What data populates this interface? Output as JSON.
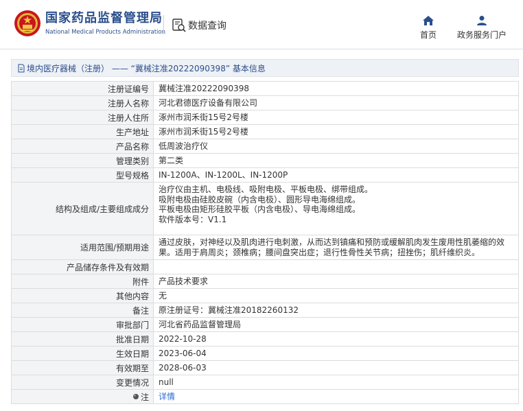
{
  "header": {
    "site_name_cn": "国家药品监督管理局",
    "site_name_en": "National Medical Products Administration",
    "data_query_label": "数据查询",
    "nav": [
      {
        "label": "首页",
        "icon": "home-icon"
      },
      {
        "label": "政务服务门户",
        "icon": "user-icon"
      }
    ],
    "brand_color": "#2b4e8c"
  },
  "breadcrumb": {
    "text": "境内医疗器械（注册） —— “冀械注准20222090398” 基本信息"
  },
  "detail": {
    "rows": [
      {
        "label": "注册证编号",
        "value": "冀械注准20222090398"
      },
      {
        "label": "注册人名称",
        "value": "河北君德医疗设备有限公司"
      },
      {
        "label": "注册人住所",
        "value": "涿州市润禾街15号2号楼"
      },
      {
        "label": "生产地址",
        "value": "涿州市润禾街15号2号楼"
      },
      {
        "label": "产品名称",
        "value": "低周波治疗仪"
      },
      {
        "label": "管理类别",
        "value": "第二类"
      },
      {
        "label": "型号规格",
        "value": "IN-1200A、IN-1200L、IN-1200P"
      }
    ],
    "structure": {
      "label": "结构及组成/主要组成成分",
      "lines": [
        "治疗仪由主机、电极线、吸附电极、平板电极、绑带组成。",
        "吸附电极由硅胶皮碗（内含电极）、圆形导电海绵组成。",
        "平板电极由矩形硅胶平板（内含电极）、导电海绵组成。",
        "软件版本号：V1.1"
      ]
    },
    "usage": {
      "label": "适用范围/预期用途",
      "lines": [
        "通过皮肤，对神经以及肌肉进行电刺激，从而达到镇痛和预防或缓解肌肉发生废用性肌萎缩的效",
        "果。适用于肩周炎；颈椎病；腰间盘突出症；退行性骨性关节病；扭挫伤；肌纤维织炎。"
      ]
    },
    "rows2": [
      {
        "label": "产品储存条件及有效期",
        "value": ""
      },
      {
        "label": "附件",
        "value": "产品技术要求"
      },
      {
        "label": "其他内容",
        "value": "无"
      },
      {
        "label": "备注",
        "value": "原注册证号：冀械注准20182260132"
      },
      {
        "label": "审批部门",
        "value": "河北省药品监督管理局"
      },
      {
        "label": "批准日期",
        "value": "2022-10-28"
      },
      {
        "label": "生效日期",
        "value": "2023-06-04"
      },
      {
        "label": "有效期至",
        "value": "2028-06-03"
      },
      {
        "label": "变更情况",
        "value": "null"
      }
    ],
    "note": {
      "label": "注",
      "value": "详情",
      "icon": "info-dot-icon"
    }
  }
}
